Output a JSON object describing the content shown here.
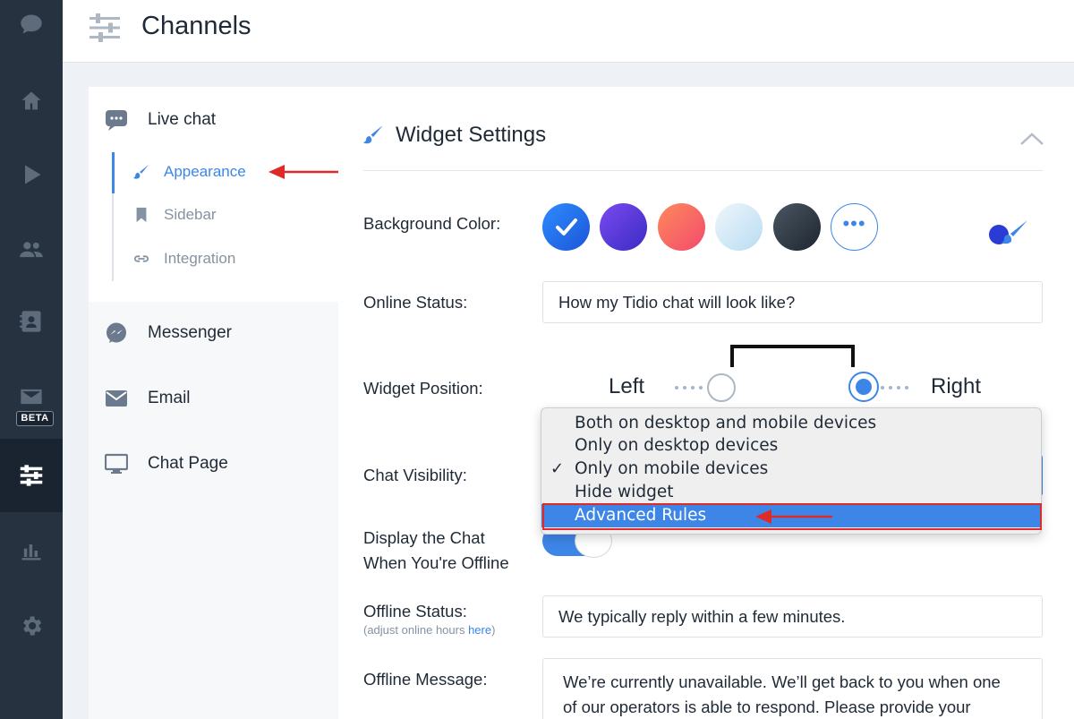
{
  "rail": {
    "items": [
      "chat",
      "home",
      "play",
      "visitors",
      "contacts",
      "mail",
      "channels",
      "analytics",
      "settings"
    ],
    "beta_label": "BETA",
    "active": "channels"
  },
  "header": {
    "title": "Channels"
  },
  "subnav": {
    "live_chat": "Live chat",
    "sub_items": [
      {
        "label": "Appearance",
        "icon": "brush-icon",
        "active": true
      },
      {
        "label": "Sidebar",
        "icon": "bookmark-icon"
      },
      {
        "label": "Integration",
        "icon": "link-icon"
      }
    ],
    "messenger": "Messenger",
    "email": "Email",
    "chat_page": "Chat Page"
  },
  "main": {
    "title": "Widget Settings",
    "background_color_label": "Background Color:",
    "swatch_colors": [
      "#1a6cf0",
      "#5b3ad9",
      "#f86560",
      "#d6eaf8",
      "#2c3540"
    ],
    "online_status_label": "Online Status:",
    "online_status_value": "How my Tidio chat will look like?",
    "widget_position_label": "Widget Position:",
    "position_left": "Left",
    "position_right": "Right",
    "position_selected": "Right",
    "chat_visibility_label": "Chat Visibility:",
    "display_offline_label_1": "Display the Chat",
    "display_offline_label_2": "When You're Offline",
    "display_offline_on": true,
    "offline_status_label": "Offline Status:",
    "offline_status_hint": "(adjust online hours ",
    "offline_status_hint_link": "here",
    "offline_status_hint_end": ")",
    "offline_status_value": "We typically reply within a few minutes.",
    "offline_message_label": "Offline Message:",
    "offline_message_line1": "We’re currently unavailable. We’ll get back to you when one",
    "offline_message_line2": "of our operators is able to respond. Please provide your"
  },
  "dropdown": {
    "options": [
      "Both on desktop and mobile devices",
      "Only on desktop devices",
      "Only on mobile devices",
      "Hide widget",
      "Advanced Rules"
    ],
    "checked": "Only on mobile devices",
    "highlighted": "Advanced Rules",
    "check_mark": "✓"
  },
  "colors": {
    "accent": "#3d86e8",
    "rail": "#263240",
    "annotation": "#e02a2a"
  }
}
